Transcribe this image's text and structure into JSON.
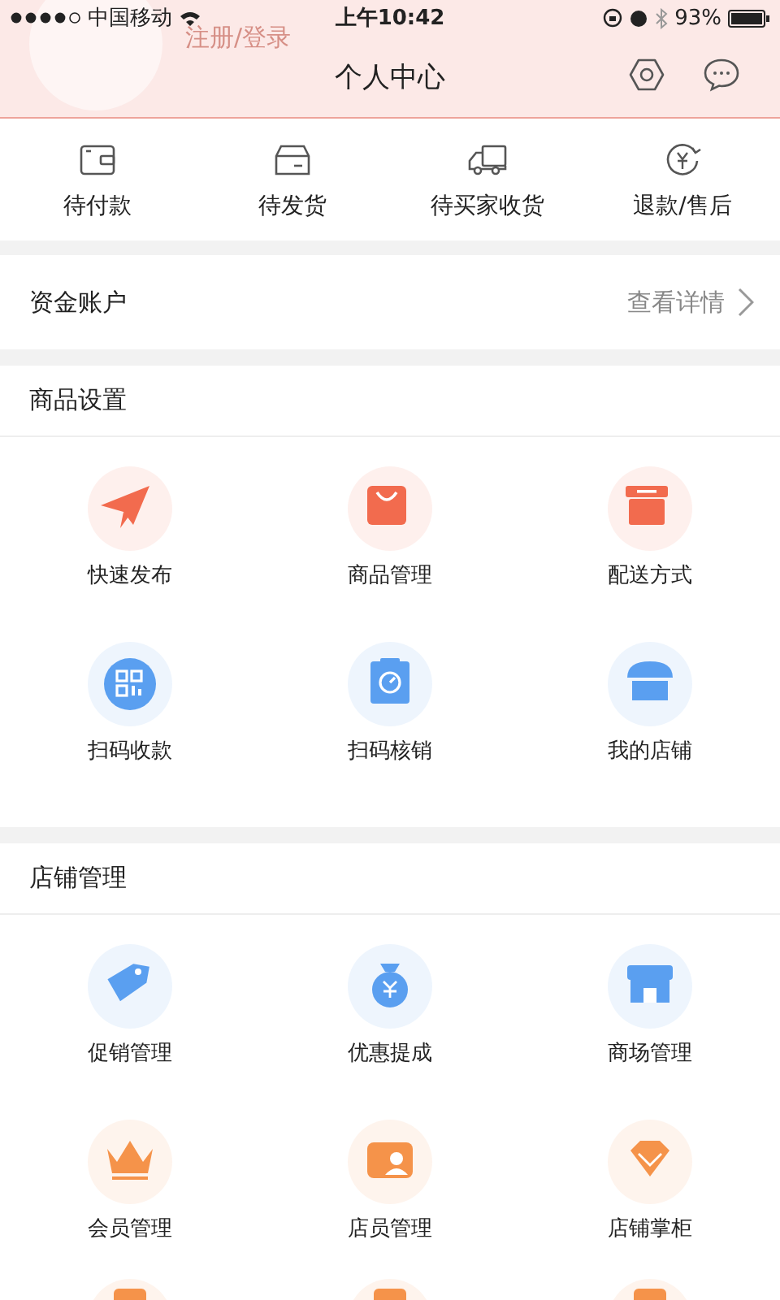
{
  "status_bar": {
    "carrier": "中国移动",
    "time": "上午10:42",
    "battery": "93%"
  },
  "header": {
    "login_text": "注册/登录",
    "title": "个人中心"
  },
  "orders": [
    {
      "kind": "wallet",
      "label": "待付款"
    },
    {
      "kind": "box",
      "label": "待发货"
    },
    {
      "kind": "truck",
      "label": "待买家收货"
    },
    {
      "kind": "refund",
      "label": "退款/售后"
    }
  ],
  "account": {
    "label": "资金账户",
    "link": "查看详情"
  },
  "sections": [
    {
      "title": "商品设置",
      "items": [
        {
          "kind": "plane",
          "label": "快速发布",
          "color": "#f26b4e"
        },
        {
          "kind": "bag",
          "label": "商品管理",
          "color": "#f26b4e"
        },
        {
          "kind": "crate",
          "label": "配送方式",
          "color": "#f26b4e"
        },
        {
          "kind": "qr",
          "label": "扫码收款",
          "color": "#5a9ff0"
        },
        {
          "kind": "scan",
          "label": "扫码核销",
          "color": "#5a9ff0"
        },
        {
          "kind": "shop",
          "label": "我的店铺",
          "color": "#5a9ff0"
        }
      ]
    },
    {
      "title": "店铺管理",
      "items": [
        {
          "kind": "tag",
          "label": "促销管理",
          "color": "#5a9ff0"
        },
        {
          "kind": "moneybag",
          "label": "优惠提成",
          "color": "#5a9ff0"
        },
        {
          "kind": "mall",
          "label": "商场管理",
          "color": "#5a9ff0"
        },
        {
          "kind": "crown",
          "label": "会员管理",
          "color": "#f5934a"
        },
        {
          "kind": "staff",
          "label": "店员管理",
          "color": "#f5934a"
        },
        {
          "kind": "diamond",
          "label": "店铺掌柜",
          "color": "#f5934a"
        },
        {
          "kind": "peek",
          "color": "#f5934a"
        },
        {
          "kind": "peek",
          "color": "#f5934a"
        },
        {
          "kind": "peek",
          "color": "#f5934a"
        }
      ]
    }
  ]
}
